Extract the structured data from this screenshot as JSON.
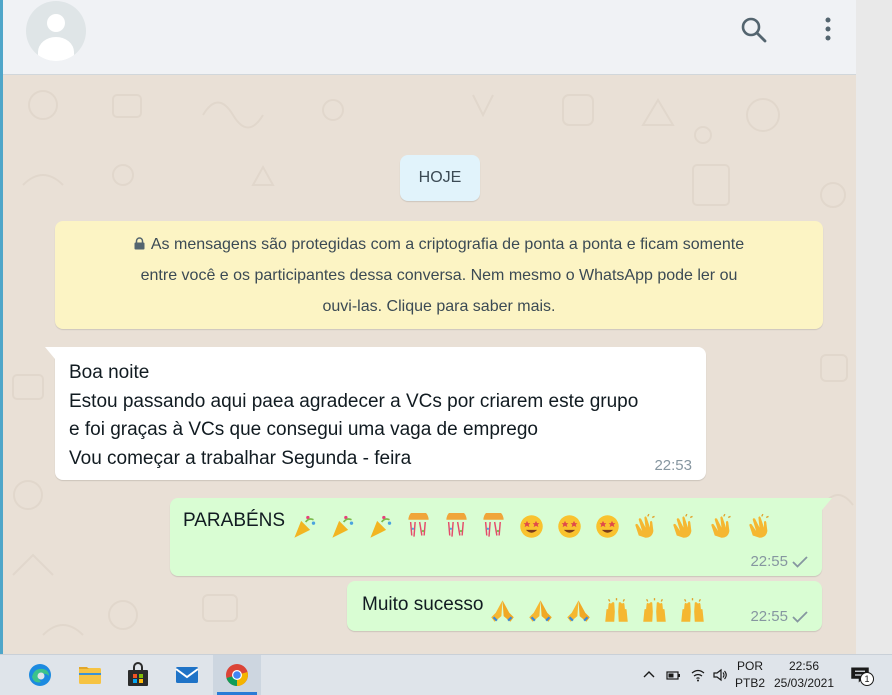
{
  "header": {
    "contact_name": "",
    "icons": [
      "avatar-placeholder",
      "search-icon",
      "kebab-menu-icon"
    ]
  },
  "chat": {
    "date_pill": "HOJE",
    "encryption_notice": {
      "line1": "As mensagens são protegidas com a criptografia de ponta a ponta e ficam somente",
      "line2": "entre você e os participantes dessa conversa. Nem mesmo o WhatsApp pode ler ou",
      "line3": "ouvi-las. Clique para saber mais."
    },
    "messages": [
      {
        "direction": "incoming",
        "lines": [
          "Boa noite",
          "Estou passando aqui paea agradecer a VCs por criarem este grupo",
          "e foi graças à VCs que consegui uma vaga de emprego",
          "Vou começar a trabalhar Segunda - feira"
        ],
        "time": "22:53"
      },
      {
        "direction": "outgoing",
        "text": "PARABÉNS",
        "emoji": [
          "party-popper",
          "party-popper",
          "party-popper",
          "confetti-ball",
          "confetti-ball",
          "confetti-ball",
          "star-struck",
          "star-struck",
          "star-struck",
          "clapping-hands",
          "clapping-hands",
          "clapping-hands",
          "clapping-hands"
        ],
        "time": "22:55",
        "status": "sent"
      },
      {
        "direction": "outgoing",
        "text": "Muito sucesso",
        "emoji": [
          "folded-hands",
          "folded-hands",
          "folded-hands",
          "raising-hands",
          "raising-hands",
          "raising-hands"
        ],
        "time": "22:55",
        "status": "sent"
      }
    ]
  },
  "taskbar": {
    "apps": [
      "edge-icon",
      "file-explorer-icon",
      "store-icon",
      "mail-icon",
      "chrome-icon"
    ],
    "language": "POR",
    "keyboard": "PTB2",
    "time": "22:56",
    "date": "25/03/2021",
    "notification_count": "1"
  },
  "colors": {
    "incoming_bubble": "#ffffff",
    "outgoing_bubble": "#d9fdd3",
    "notice_bg": "#fcf4c4",
    "date_pill_bg": "#e1f3fb",
    "chat_bg": "#e9e0d6",
    "meta_text": "#8696a0"
  }
}
